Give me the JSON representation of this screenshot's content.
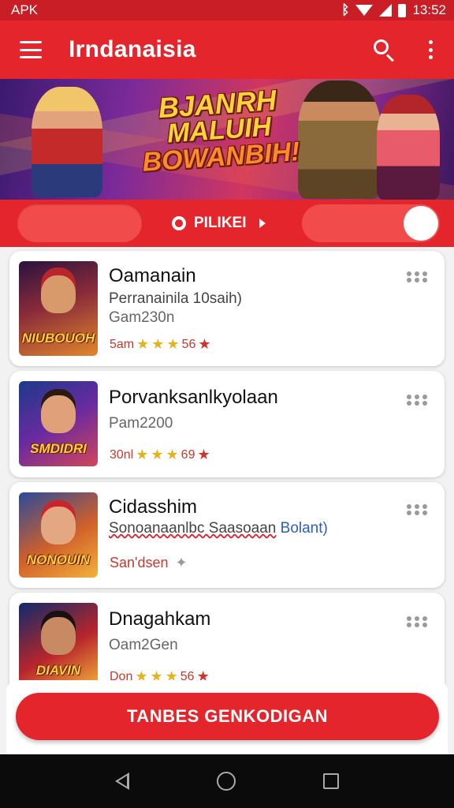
{
  "status_bar": {
    "carrier": "APK",
    "time": "13:52",
    "icons": [
      "bluetooth-icon",
      "wifi-icon",
      "signal-icon",
      "battery-icon"
    ]
  },
  "app_bar": {
    "title": "Irndanaisia",
    "menu_icon": "hamburger-menu-icon",
    "search_icon": "search-icon",
    "overflow_icon": "more-vert-icon"
  },
  "banner": {
    "title_line1": "BJANRH",
    "title_line2": "MALUIH",
    "title_line3": "BOWANBIH!"
  },
  "filter_bar": {
    "center_label": "PILIKEI",
    "toggle_on": true
  },
  "games": [
    {
      "title": "Oamanain",
      "subtitle": "Perranainila 10saih)",
      "detail": "Gam230n",
      "rating_label": "5am",
      "rating_value": "56",
      "thumb_caption": "NIUBOUOH"
    },
    {
      "title": "Porvanksanlkyolaan",
      "subtitle": "",
      "detail": "Pam2200",
      "rating_label": "30nl",
      "rating_value": "69",
      "thumb_caption": "SMDIDRI"
    },
    {
      "title": "Cidasshim",
      "subtitle": "Sonoanaanlbc Saasoaan",
      "subtitle_accent": "Bolant)",
      "detail": "",
      "rating_label": "San'dsen",
      "rating_value": "",
      "thumb_caption": "NONOUIN"
    },
    {
      "title": "Dnagahkam",
      "subtitle": "",
      "detail": "Oam2Gen",
      "rating_label": "Don",
      "rating_value": "56",
      "thumb_caption": "DIAVIN"
    }
  ],
  "cta": {
    "label": "TANBES GENKODIGAN"
  },
  "colors": {
    "primary": "#e4262c",
    "primary_dark": "#c91e25",
    "star": "#e8b21f"
  }
}
